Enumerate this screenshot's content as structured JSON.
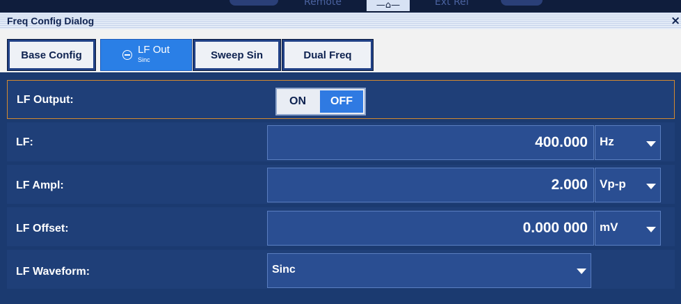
{
  "topbar": {
    "remote_label": "Remote",
    "home_glyph": "—⌂—",
    "extref_label": "Ext Ref"
  },
  "dialog": {
    "title": "Freq Config Dialog",
    "close_glyph": "×"
  },
  "tabs": [
    {
      "label": "Base Config",
      "active": false
    },
    {
      "label": "LF Out",
      "sublabel": "Sinc",
      "active": true
    },
    {
      "label": "Sweep Sin",
      "active": false
    },
    {
      "label": "Dual Freq",
      "active": false
    }
  ],
  "lf_output": {
    "label": "LF Output:",
    "on_label": "ON",
    "off_label": "OFF",
    "selected": "OFF"
  },
  "lf": {
    "label": "LF:",
    "value": "400.000",
    "unit": "Hz"
  },
  "lf_ampl": {
    "label": "LF Ampl:",
    "value": "2.000",
    "unit": "Vp-p"
  },
  "lf_offset": {
    "label": "LF Offset:",
    "value": "0.000 000",
    "unit": "mV"
  },
  "lf_waveform": {
    "label": "LF Waveform:",
    "value": "Sinc"
  },
  "colors": {
    "accent": "#2f7ae2",
    "panel": "#1b3a70",
    "field": "#2a4e92",
    "focus_border": "#d58a2e"
  }
}
